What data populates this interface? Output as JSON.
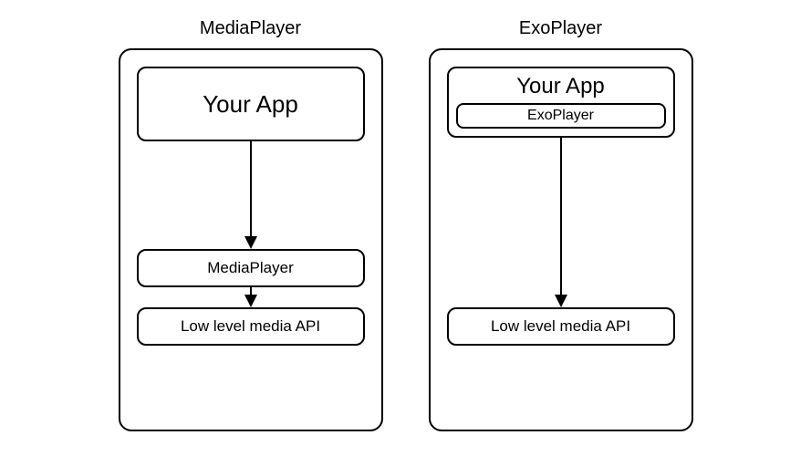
{
  "left": {
    "title": "MediaPlayer",
    "your_app": "Your App",
    "media_player": "MediaPlayer",
    "low_level": "Low level media API"
  },
  "right": {
    "title": "ExoPlayer",
    "your_app": "Your App",
    "exo_player": "ExoPlayer",
    "low_level": "Low level media API"
  }
}
